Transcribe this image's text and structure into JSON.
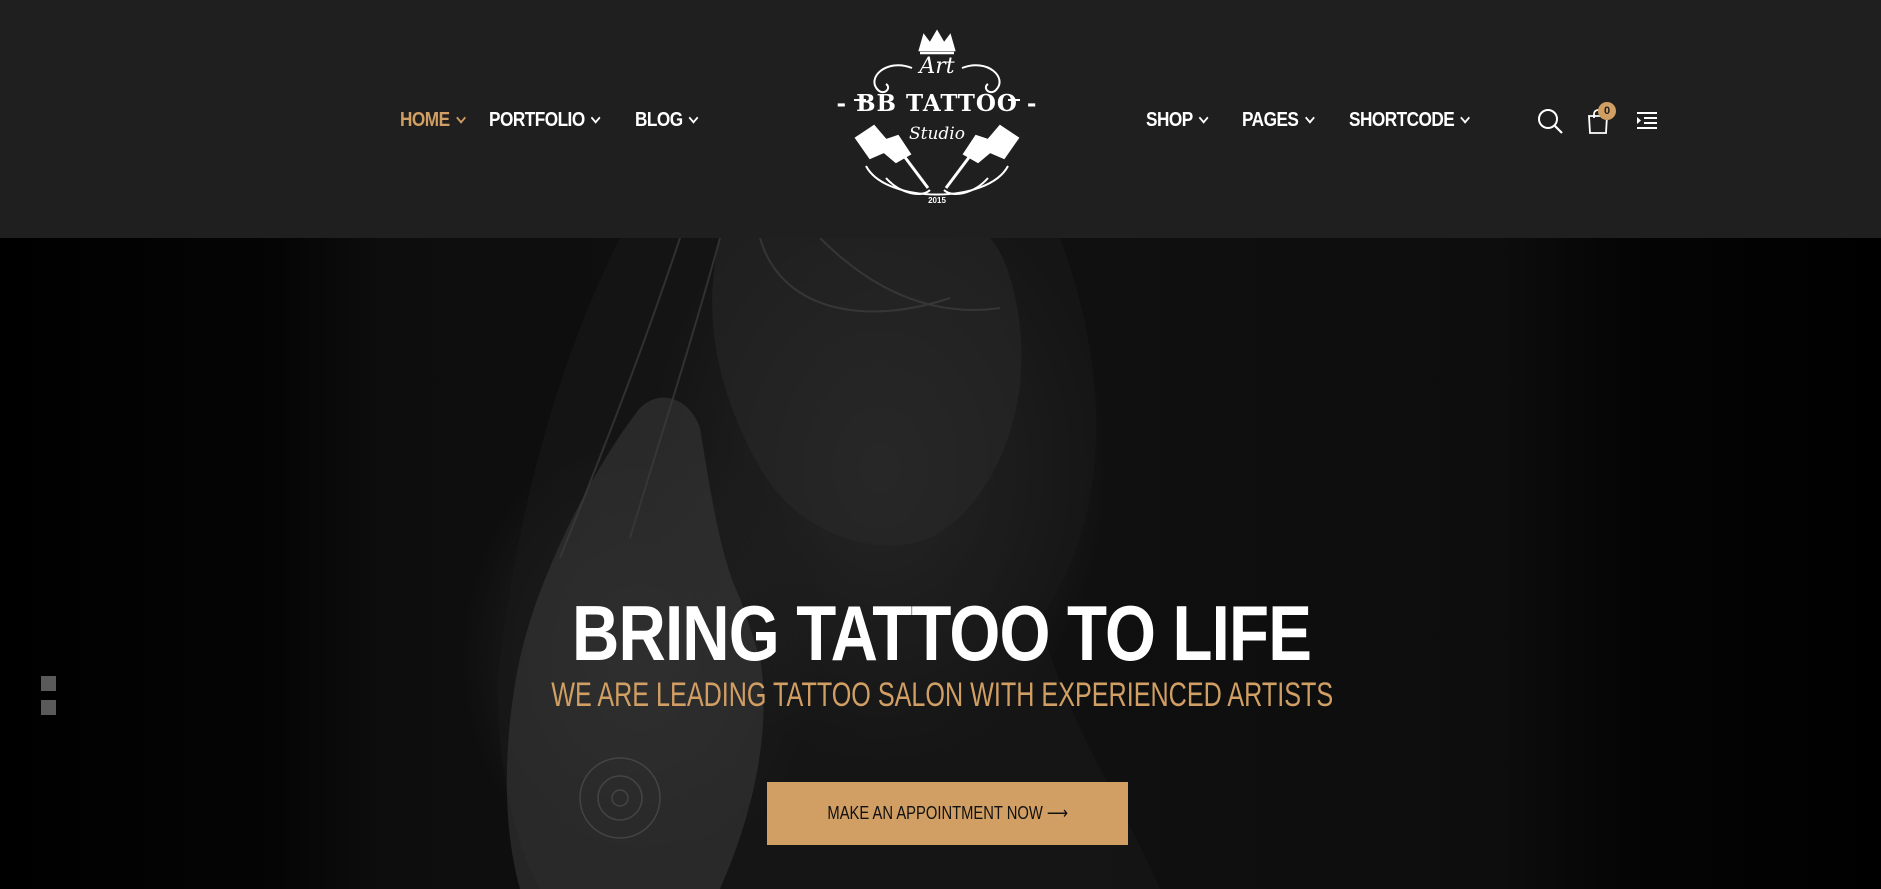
{
  "nav_left": [
    {
      "label": "HOME",
      "active": true
    },
    {
      "label": "PORTFOLIO",
      "active": false
    },
    {
      "label": "BLOG",
      "active": false
    }
  ],
  "nav_right": [
    {
      "label": "SHOP"
    },
    {
      "label": "PAGES"
    },
    {
      "label": "SHORTCODE"
    }
  ],
  "logo": {
    "art": "Art",
    "title": "- BB TATTOO -",
    "studio": "Studio",
    "year": "2015"
  },
  "cart": {
    "count": "0"
  },
  "hero": {
    "title": "BRING TATTOO TO LIFE",
    "subtitle": "WE ARE LEADING TATTOO SALON WITH EXPERIENCED ARTISTS",
    "cta_label": "MAKE AN APPOINTMENT NOW ⟶"
  },
  "slider": {
    "dots": 2
  },
  "colors": {
    "accent": "#d19e63",
    "header_bg": "#1f1f1f",
    "hero_bg": "#0a0a0a",
    "text": "#ffffff"
  },
  "icons": [
    "chevron-down-icon",
    "search-icon",
    "cart-icon",
    "menu-icon",
    "crown-icon",
    "tattoo-machine-icon"
  ]
}
